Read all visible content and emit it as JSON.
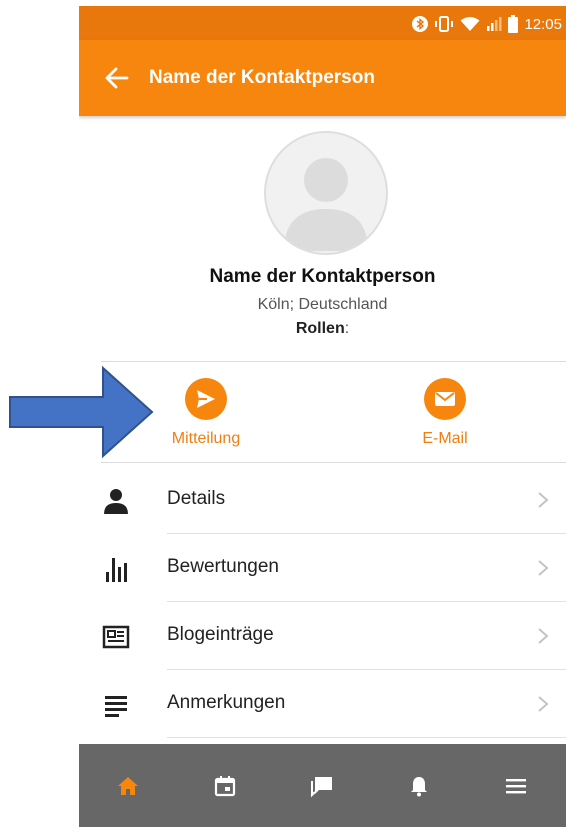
{
  "status_bar": {
    "time": "12:05",
    "icons": [
      "bluetooth-icon",
      "vibrate-icon",
      "wifi-icon",
      "signal-icon",
      "battery-icon"
    ]
  },
  "app_bar": {
    "title": "Name der Kontaktperson",
    "back_icon": "arrow-left-icon"
  },
  "profile": {
    "name": "Name der Kontaktperson",
    "location": "Köln; Deutschland",
    "roles_label": "Rollen",
    "roles_sep": ":"
  },
  "actions": [
    {
      "label": "Mitteilung",
      "icon": "send-icon"
    },
    {
      "label": "E-Mail",
      "icon": "mail-icon"
    }
  ],
  "menu": [
    {
      "label": "Details",
      "icon": "person-icon"
    },
    {
      "label": "Bewertungen",
      "icon": "bar-chart-icon"
    },
    {
      "label": "Blogeinträge",
      "icon": "newspaper-icon"
    },
    {
      "label": "Anmerkungen",
      "icon": "notes-icon"
    }
  ],
  "bottom_nav": [
    "home-icon",
    "calendar-icon",
    "chat-icon",
    "bell-icon",
    "menu-icon"
  ],
  "colors": {
    "accent": "#f7860f",
    "status_bar": "#e8770c",
    "nav_bg": "#676767",
    "annotation_arrow": "#4472c4"
  }
}
